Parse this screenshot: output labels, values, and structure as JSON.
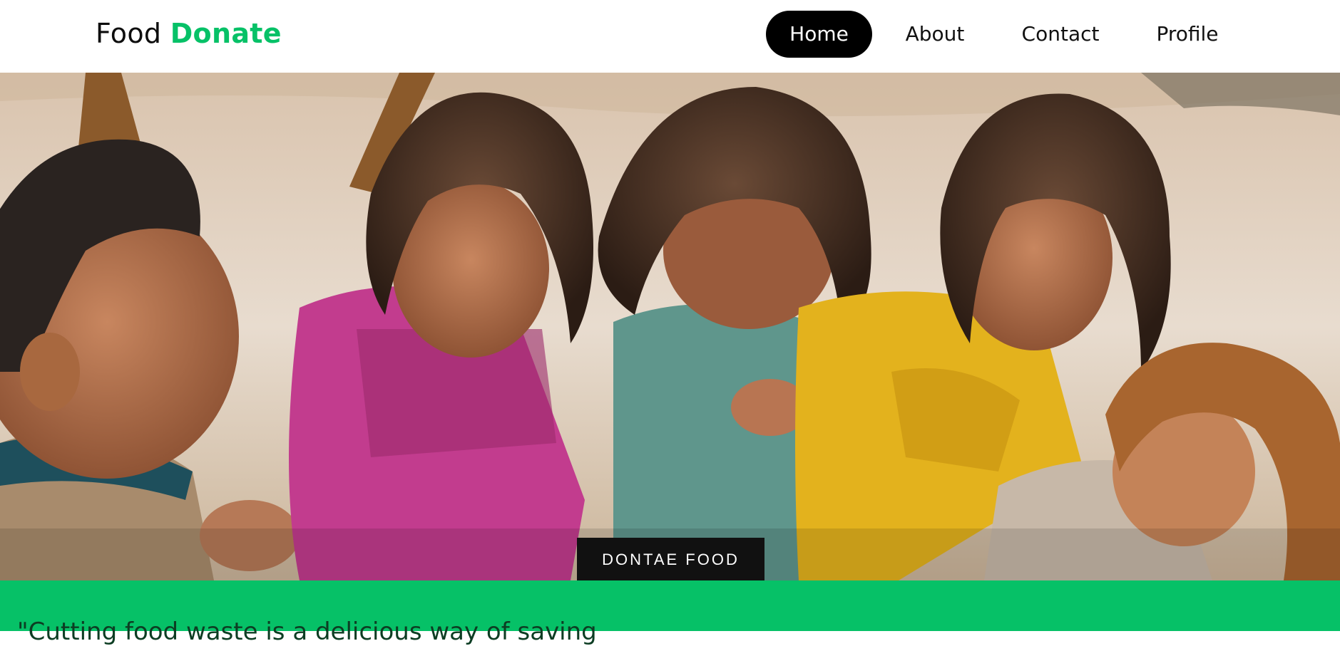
{
  "brand": {
    "name_part1": "Food",
    "name_part2": "Donate",
    "accent_color": "#06c167"
  },
  "nav": {
    "items": [
      {
        "label": "Home",
        "active": true
      },
      {
        "label": "About",
        "active": false
      },
      {
        "label": "Contact",
        "active": false
      },
      {
        "label": "Profile",
        "active": false
      }
    ]
  },
  "hero": {
    "cta_label": "DONTAE FOOD"
  },
  "band": {
    "partial_text": "\"Cutting food waste is a delicious way of saving"
  }
}
